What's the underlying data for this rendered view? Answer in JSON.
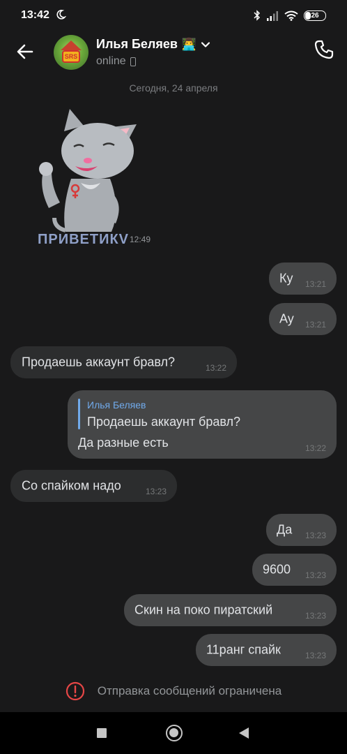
{
  "status_bar": {
    "time": "13:42",
    "battery": "26"
  },
  "header": {
    "name": "Илья Беляев",
    "name_emoji": "👨‍💻",
    "presence": "online",
    "avatar_text": "SRS"
  },
  "date_divider": "Сегодня, 24 апреля",
  "sticker": {
    "caption": "ПРИВЕТИКV",
    "time": "12:49"
  },
  "messages": [
    {
      "text": "Ку",
      "time": "13:21",
      "direction": "out"
    },
    {
      "text": "Ау",
      "time": "13:21",
      "direction": "out"
    },
    {
      "text": "Продаешь аккаунт бравл?",
      "time": "13:22",
      "direction": "in"
    },
    {
      "reply_name": "Илья Беляев",
      "reply_text": "Продаешь аккаунт бравл?",
      "text": "Да разные есть",
      "time": "13:22",
      "direction": "out"
    },
    {
      "text": "Со спайком надо",
      "time": "13:23",
      "direction": "in"
    },
    {
      "text": "Да",
      "time": "13:23",
      "direction": "out"
    },
    {
      "text": "9600",
      "time": "13:23",
      "direction": "out"
    },
    {
      "text": "Скин на поко пиратский",
      "time": "13:23",
      "direction": "out"
    },
    {
      "text": "11ранг спайк",
      "time": "13:23",
      "direction": "out"
    }
  ],
  "restriction_notice": "Отправка сообщений ограничена",
  "colors": {
    "background": "#19191a",
    "incoming_bubble": "#2c2d2e",
    "outgoing_bubble": "#454647",
    "accent": "#71aaeb",
    "alert": "#e64646"
  },
  "icons": {
    "back": "arrow-left-icon",
    "call": "phone-icon",
    "dropdown": "chevron-down-icon",
    "alert": "exclamation-circle-icon"
  }
}
